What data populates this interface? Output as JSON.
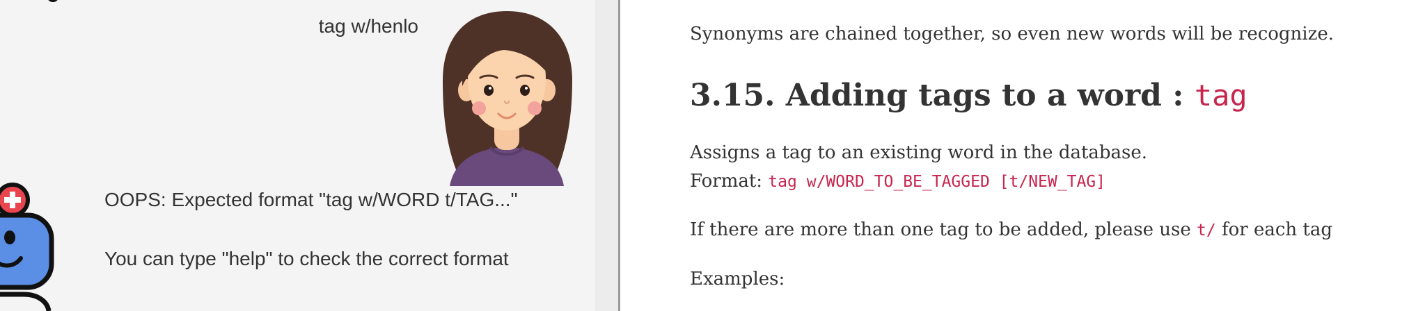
{
  "chat": {
    "user_message": "tag w/henlo",
    "bot_messages": [
      "OOPS: Expected format \"tag w/WORD t/TAG...\"",
      "You can type \"help\" to check the correct format"
    ]
  },
  "docs": {
    "synonyms_text": "Synonyms are chained together, so even new words will be recognize.",
    "section": {
      "heading_text": "3.15. Adding tags to a word : ",
      "heading_code": "tag",
      "description": "Assigns a tag to an existing word in the database.",
      "format_label": "Format: ",
      "format_code": "tag w/WORD_TO_BE_TAGGED [t/NEW_TAG]",
      "multi_prefix": "If there are more than one tag to be added, please use ",
      "multi_code": "t/",
      "multi_suffix": " for each tag",
      "examples_label": "Examples:"
    }
  },
  "colors": {
    "code": "#c7254e",
    "chat_background": "#f4f4f4",
    "doc_text": "#333333"
  },
  "icons": {
    "user_avatar": "girl-avatar-icon",
    "bot_avatar": "robot-avatar-icon"
  }
}
